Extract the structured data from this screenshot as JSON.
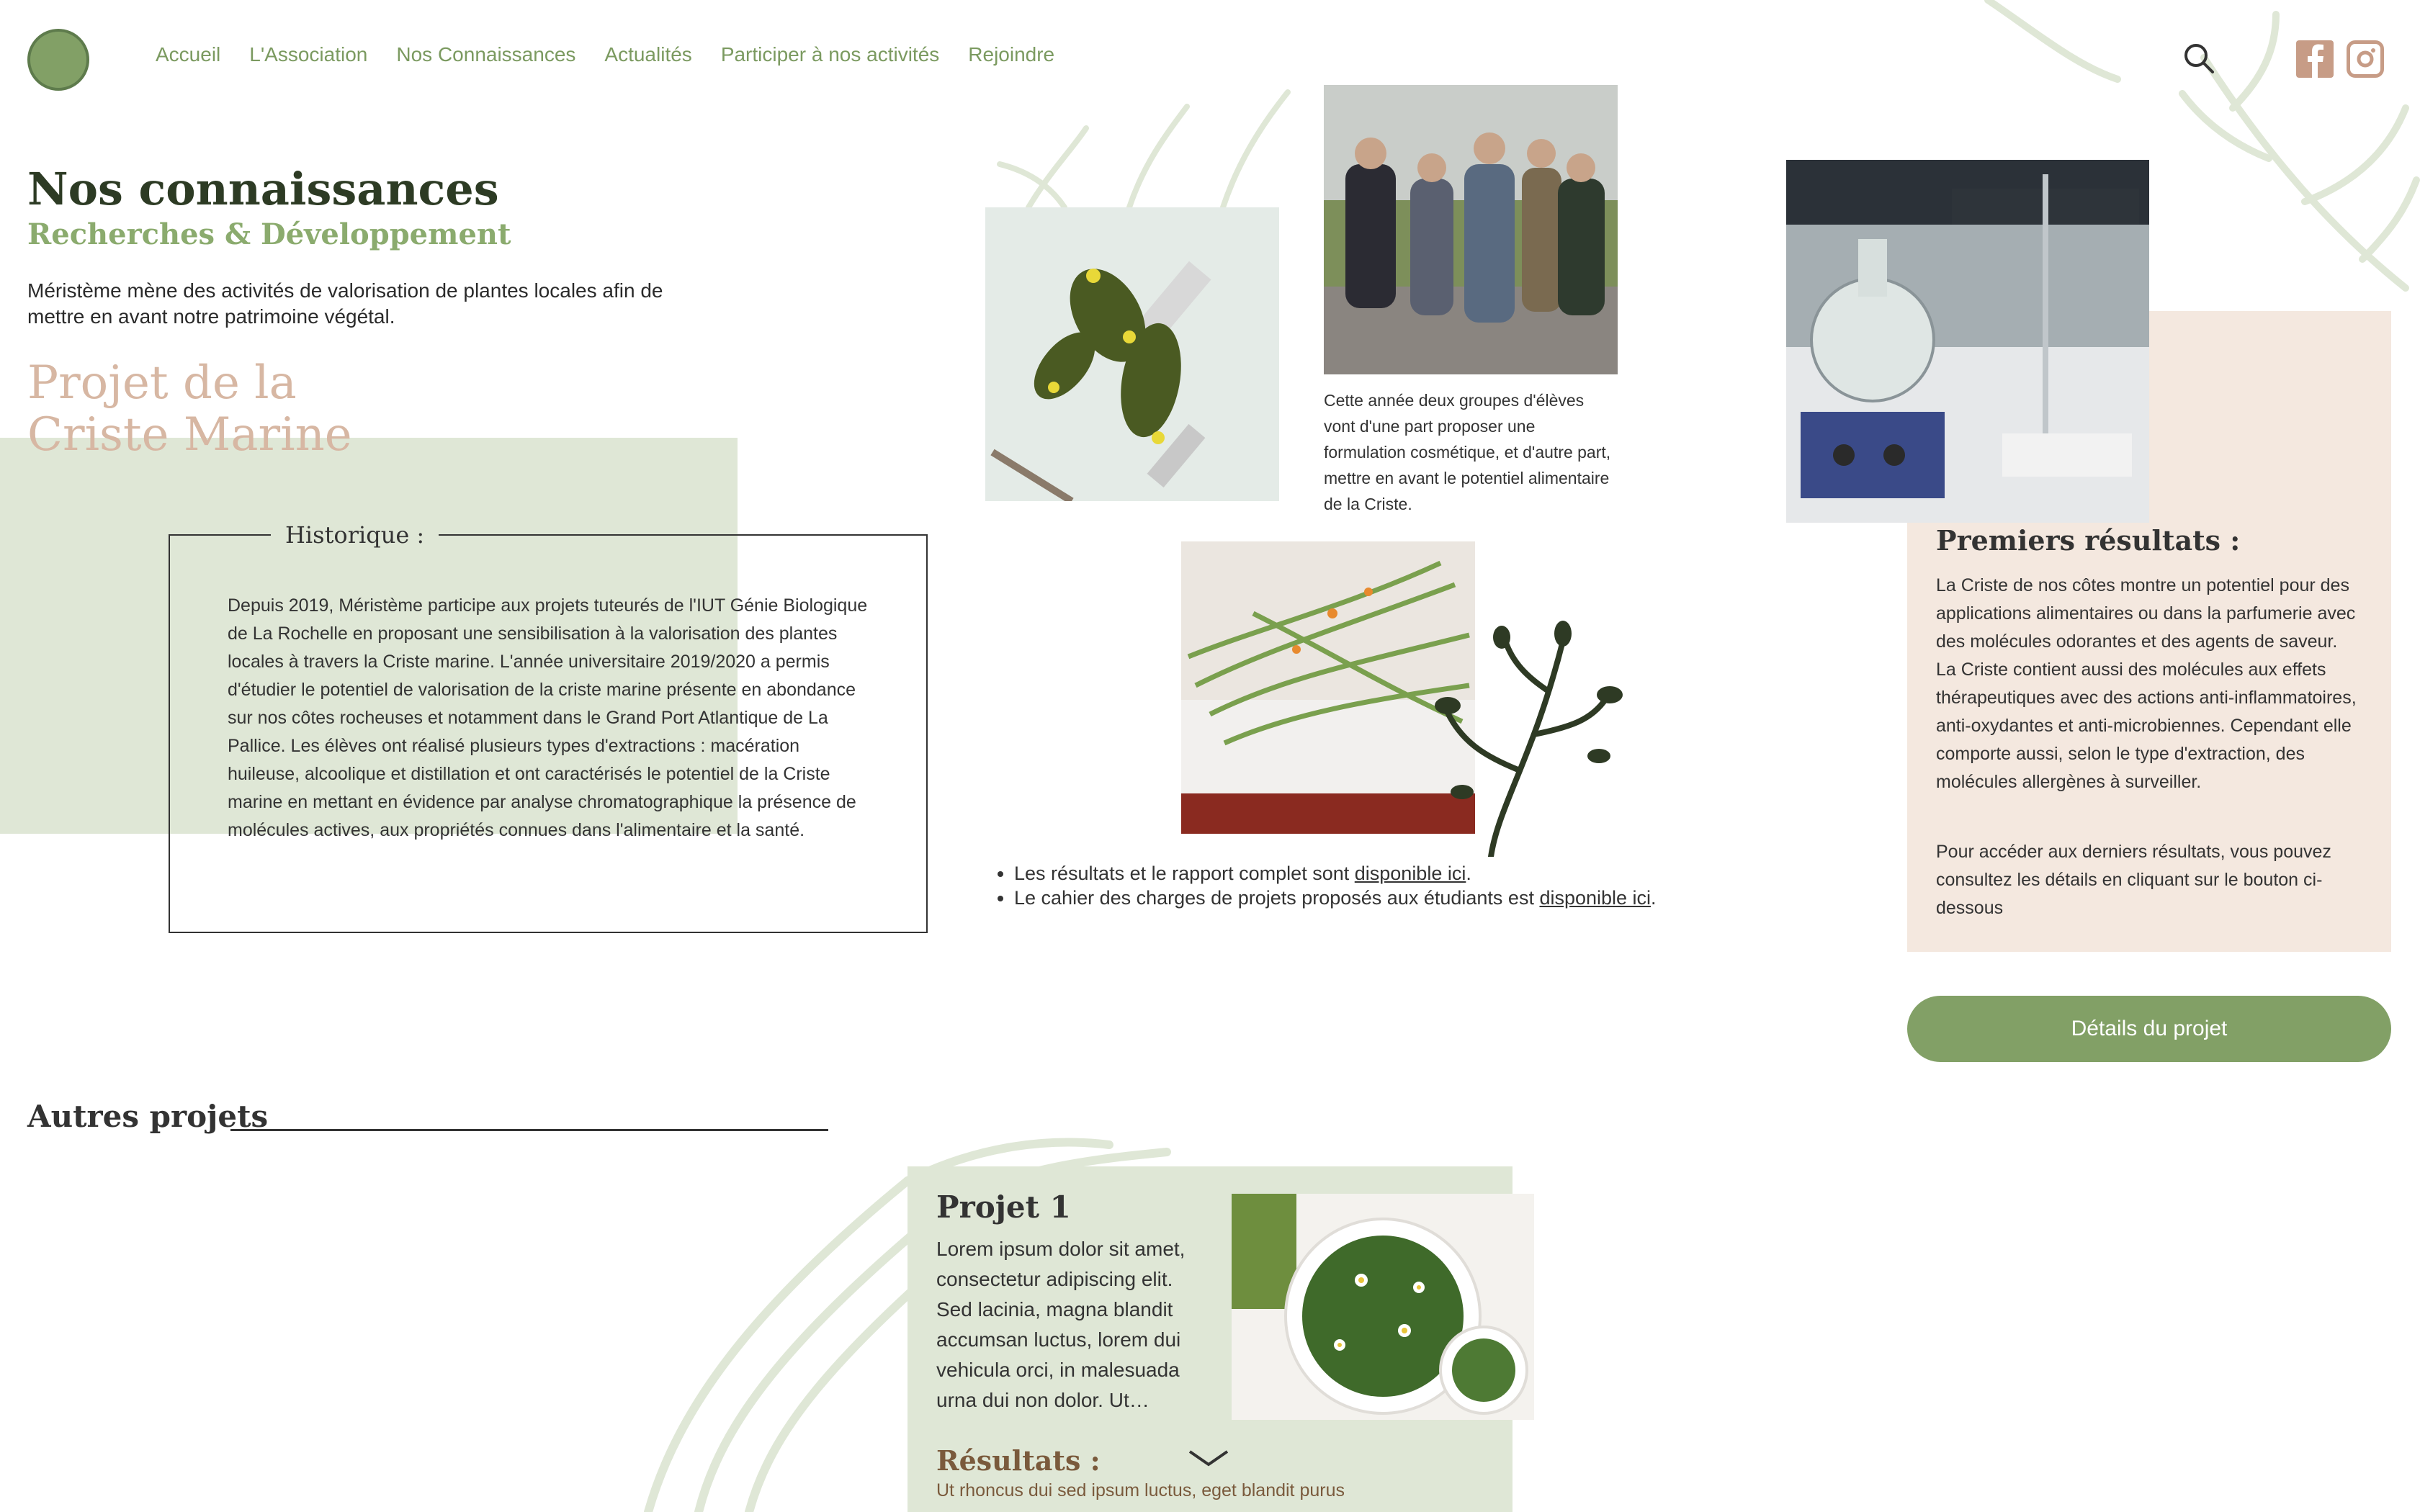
{
  "nav": {
    "items": [
      "Accueil",
      "L'Association",
      "Nos Connaissances",
      "Actualités",
      "Participer à nos activités",
      "Rejoindre"
    ]
  },
  "header": {
    "title": "Nos connaissances",
    "subtitle": "Recherches & Développement",
    "intro": "Méristème mène des activités de valorisation de plantes locales afin de mettre en avant notre patrimoine végétal."
  },
  "project": {
    "title_line1": "Projet de la",
    "title_line2": "Criste Marine",
    "historique_label": "Historique :",
    "historique_text": "Depuis 2019, Méristème participe aux projets tuteurés de l'IUT Génie Biologique de La Rochelle en proposant une sensibilisation à la valorisation des plantes locales à travers la Criste marine. L'année universitaire 2019/2020 a permis d'étudier le potentiel de valorisation de la criste marine présente en abondance sur nos côtes rocheuses et notamment dans le Grand Port Atlantique de La Pallice. Les élèves ont réalisé plusieurs types d'extractions : macération huileuse, alcoolique et distillation et ont caractérisés le potentiel de la Criste marine en mettant en évidence par analyse chromatographique la présence de molécules actives, aux propriétés connues dans l'alimentaire et la santé.",
    "photo_caption": "Cette année deux groupes d'élèves vont d'une part proposer une formulation cosmétique, et d'autre part, mettre en avant le potentiel alimentaire de la Criste.",
    "result_1_text": "Les résultats et le rapport complet sont ",
    "result_1_link": "disponible ici",
    "result_2_text": "Le cahier des charges de projets proposés aux étudiants est ",
    "result_2_link": "disponible ici"
  },
  "premiers": {
    "title": "Premiers résultats :",
    "text1": "La Criste de nos côtes montre un potentiel pour des applications alimentaires ou dans la parfumerie avec des molécules odorantes et des agents de saveur. La Criste contient aussi des molécules aux effets thérapeutiques avec des actions anti-inflammatoires, anti-oxydantes et anti-microbiennes. Cependant elle comporte aussi, selon le type d'extraction, des molécules allergènes à surveiller.",
    "text2": "Pour accéder aux derniers résultats, vous pouvez consultez les détails en cliquant sur le bouton ci-dessous",
    "button": "Détails du projet"
  },
  "autres": {
    "title": "Autres projets",
    "card": {
      "title": "Projet 1",
      "text": "Lorem ipsum dolor sit amet, consectetur adipiscing elit. Sed lacinia, magna blandit accumsan luctus, lorem dui vehicula orci, in malesuada urna dui non dolor. Ut…",
      "results_label": "Résultats :",
      "results_text": "Ut rhoncus dui sed ipsum luctus, eget blandit purus"
    }
  },
  "colors": {
    "accent_green": "#82a066",
    "light_green": "#dfe7d6",
    "peach": "#f4e8df",
    "title_peach": "#d7b7a3"
  },
  "icons": [
    "logo",
    "search-icon",
    "facebook-icon",
    "instagram-icon",
    "chevron-down-icon"
  ]
}
